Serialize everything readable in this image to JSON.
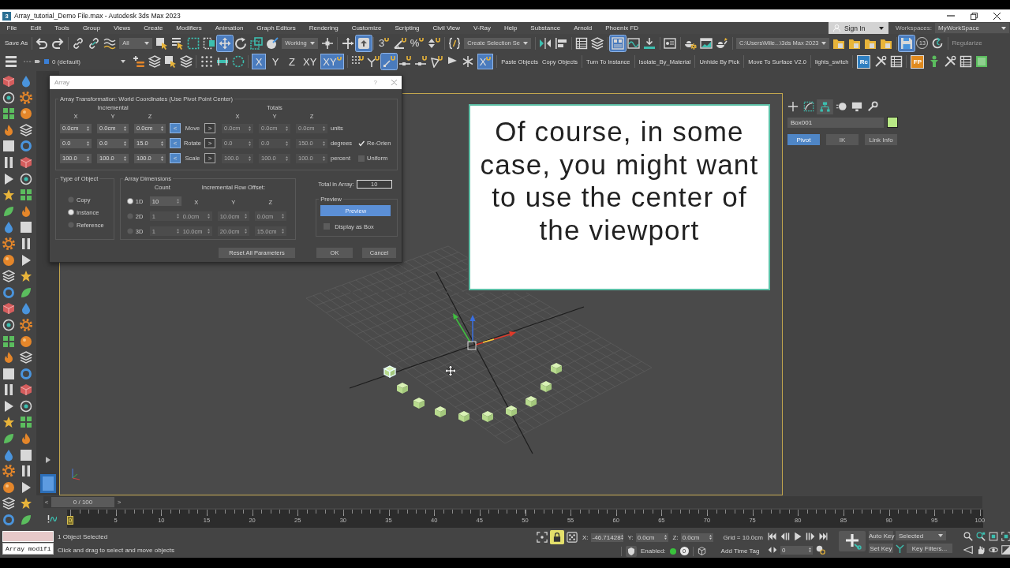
{
  "window": {
    "logo": "3",
    "title": "Array_tutorial_Demo File.max - Autodesk 3ds Max 2023"
  },
  "menu_bar": {
    "items": [
      "File",
      "Edit",
      "Tools",
      "Group",
      "Views",
      "Create",
      "Modifiers",
      "Animation",
      "Graph Editors",
      "Rendering",
      "Customize",
      "Scripting",
      "Civil View",
      "V-Ray",
      "Help",
      "Substance",
      "Arnold",
      "Phoenix FD"
    ],
    "sign_in": "Sign In",
    "workspaces_label": "Workspaces:",
    "workspace": "MyWorkSpace"
  },
  "main_toolbar": [
    [
      {
        "kind": "text",
        "label": "Save As",
        "disabled": false
      }
    ],
    [
      {
        "kind": "undo",
        "active": false
      },
      {
        "kind": "redo",
        "active": false
      }
    ],
    [
      {
        "kind": "link",
        "active": false
      },
      {
        "kind": "unlink",
        "active": false
      },
      {
        "kind": "bind",
        "active": false
      },
      {
        "kind": "dropdown",
        "value": "All"
      },
      {
        "kind": "select",
        "active": false
      },
      {
        "kind": "select-list",
        "active": false
      },
      {
        "kind": "region",
        "active": false
      },
      {
        "kind": "window",
        "active": false
      },
      {
        "kind": "move",
        "active": true
      },
      {
        "kind": "rotate",
        "active": false
      },
      {
        "kind": "scale",
        "active": false
      },
      {
        "kind": "place",
        "active": false
      },
      {
        "kind": "dropdown",
        "value": "Working"
      },
      {
        "kind": "pivot",
        "active": false
      }
    ],
    [
      {
        "kind": "manipulate",
        "active": false
      },
      {
        "kind": "override",
        "active": true
      }
    ],
    [
      {
        "kind": "snap",
        "label": "3",
        "active": false
      },
      {
        "kind": "angle",
        "active": false
      },
      {
        "kind": "snap",
        "label": "%",
        "active": false
      },
      {
        "kind": "spinner",
        "active": false
      }
    ],
    [
      {
        "kind": "braces",
        "active": false
      },
      {
        "kind": "dropdown",
        "value": "Create Selection Se"
      }
    ],
    [
      {
        "kind": "mirror",
        "active": false
      },
      {
        "kind": "align",
        "active": false
      }
    ],
    [
      {
        "kind": "table",
        "active": false
      },
      {
        "kind": "stack",
        "active": false
      }
    ],
    [
      {
        "kind": "ribbon",
        "active": true
      },
      {
        "kind": "curve",
        "active": false
      },
      {
        "kind": "tray",
        "active": false
      }
    ],
    [
      {
        "kind": "material",
        "active": false
      }
    ],
    [
      {
        "kind": "teapot-gear",
        "active": false
      },
      {
        "kind": "frame",
        "active": false
      },
      {
        "kind": "teapot",
        "active": false
      }
    ],
    [
      {
        "kind": "dropdown",
        "value": "C:\\Users\\Mile...\\3ds Max 2023"
      },
      {
        "kind": "folder",
        "active": false
      },
      {
        "kind": "folder",
        "active": false
      },
      {
        "kind": "folder",
        "active": false
      },
      {
        "kind": "folder",
        "active": false
      }
    ],
    [
      {
        "kind": "floppy",
        "active": true
      },
      {
        "kind": "counter",
        "label": "13"
      },
      {
        "kind": "refresh",
        "active": false
      }
    ],
    [
      {
        "kind": "text",
        "label": "Regularize",
        "disabled": true
      }
    ]
  ],
  "secondary_toolbar": [
    [
      {
        "kind": "stack-lines",
        "active": false
      },
      {
        "kind": "layer-dropdown",
        "value": "0 (default)"
      },
      {
        "kind": "add-layer",
        "active": false
      },
      {
        "kind": "stack",
        "active": false
      },
      {
        "kind": "select",
        "active": false
      },
      {
        "kind": "stack",
        "active": false
      }
    ],
    [
      {
        "kind": "dot-grid",
        "active": false
      },
      {
        "kind": "track",
        "active": false
      },
      {
        "kind": "dashed-circle",
        "active": false
      }
    ],
    [
      {
        "kind": "axis",
        "label": "X",
        "active": true
      },
      {
        "kind": "axis",
        "label": "Y",
        "active": false
      },
      {
        "kind": "axis",
        "label": "Z",
        "active": false
      },
      {
        "kind": "axis",
        "label": "XY",
        "active": false
      },
      {
        "kind": "snap",
        "label": "XY",
        "active": true
      }
    ],
    [
      {
        "kind": "dot-snap",
        "active": false
      },
      {
        "kind": "fork",
        "active": false
      },
      {
        "kind": "hook",
        "active": true
      },
      {
        "kind": "dash-snap",
        "active": false
      },
      {
        "kind": "dash-snap",
        "active": false
      },
      {
        "kind": "triangle",
        "active": false
      },
      {
        "kind": "flag",
        "active": false
      },
      {
        "kind": "snowflake",
        "active": false
      },
      {
        "kind": "snap",
        "label": "X",
        "active": true
      }
    ],
    [
      {
        "kind": "text",
        "label": "Paste Objects",
        "disabled": false
      },
      {
        "kind": "text",
        "label": "Copy Objects",
        "disabled": false
      }
    ],
    [
      {
        "kind": "text",
        "label": "Turn To Instance",
        "disabled": false
      }
    ],
    [
      {
        "kind": "text",
        "label": "Isolate_By_Material",
        "disabled": false
      }
    ],
    [
      {
        "kind": "text",
        "label": "Unhide By Pick",
        "disabled": false
      }
    ],
    [
      {
        "kind": "text",
        "label": "Move To Surface V2.0",
        "disabled": false
      }
    ],
    [
      {
        "kind": "text",
        "label": "lights_switch",
        "disabled": false
      }
    ],
    [
      {
        "kind": "tile",
        "label": "Rc",
        "color": "#2f7fc1"
      },
      {
        "kind": "tools",
        "active": false
      },
      {
        "kind": "table",
        "active": false
      }
    ],
    [
      {
        "kind": "tile",
        "label": "FP",
        "color": "#e08a1e"
      },
      {
        "kind": "figure",
        "active": false
      },
      {
        "kind": "tools",
        "active": false
      },
      {
        "kind": "table",
        "active": false
      },
      {
        "kind": "green-box",
        "active": false
      }
    ]
  ],
  "array_dialog": {
    "title": "Array",
    "help": "?",
    "group_title": "Array Transformation: World Coordinates (Use Pivot Point Center)",
    "incremental_label": "Incremental",
    "totals_label": "Totals",
    "incremental_axes": [
      "X",
      "Y",
      "Z"
    ],
    "totals_axes": [
      "X",
      "Y",
      "Z"
    ],
    "rows": [
      {
        "label": "Move",
        "incremental": [
          "0.0cm",
          "0.0cm",
          "0.0cm"
        ],
        "left_button": {
          "label": "<",
          "selected": true
        },
        "right_button": {
          "label": ">",
          "selected": false
        },
        "totals": [
          "0.0cm",
          "0.0cm",
          "0.0cm"
        ],
        "unit": "units"
      },
      {
        "label": "Rotate",
        "incremental": [
          "0.0",
          "0.0",
          "15.0"
        ],
        "left_button": {
          "label": "<",
          "selected": true
        },
        "right_button": {
          "label": ">",
          "selected": false
        },
        "totals": [
          "0.0",
          "0.0",
          "150.0"
        ],
        "unit": "degrees",
        "option": {
          "label": "Re-Orien",
          "checked": true
        }
      },
      {
        "label": "Scale",
        "incremental": [
          "100.0",
          "100.0",
          "100.0"
        ],
        "left_button": {
          "label": "<",
          "selected": true
        },
        "right_button": {
          "label": ">",
          "selected": false
        },
        "totals": [
          "100.0",
          "100.0",
          "100.0"
        ],
        "unit": "percent",
        "option": {
          "label": "Uniform",
          "checked": false
        }
      }
    ],
    "type_of_object": {
      "title": "Type of Object",
      "options": [
        {
          "label": "Copy",
          "selected": false
        },
        {
          "label": "Instance",
          "selected": true
        },
        {
          "label": "Reference",
          "selected": false
        }
      ]
    },
    "array_dimensions": {
      "title": "Array Dimensions",
      "count_label": "Count",
      "offset_label": "Incremental Row Offset:",
      "axes": [
        "X",
        "Y",
        "Z"
      ],
      "rows": [
        {
          "label": "1D",
          "selected": true,
          "count": "10"
        },
        {
          "label": "2D",
          "selected": false,
          "count": "1",
          "offsets": [
            "0.0cm",
            "10.0cm",
            "0.0cm"
          ]
        },
        {
          "label": "3D",
          "selected": false,
          "count": "1",
          "offsets": [
            "10.0cm",
            "20.0cm",
            "15.0cm"
          ]
        }
      ]
    },
    "total_label": "Total in Array:",
    "total": "10",
    "preview": {
      "title": "Preview",
      "button": {
        "label": "Preview",
        "on": true
      },
      "display_as_box": {
        "label": "Display as Box",
        "checked": false
      }
    },
    "buttons": [
      "Reset All Parameters",
      "OK",
      "Cancel"
    ]
  },
  "viewport": {
    "objects": [
      {
        "selected": true
      },
      {
        "selected": false
      },
      {
        "selected": false
      },
      {
        "selected": false
      },
      {
        "selected": false
      },
      {
        "selected": false
      },
      {
        "selected": false
      },
      {
        "selected": false
      },
      {
        "selected": false
      },
      {
        "selected": false
      }
    ]
  },
  "caption": "Of course, in some case, you might want to use the center of the viewport",
  "command_panel": {
    "tabs": [
      {
        "kind": "create",
        "selected": false
      },
      {
        "kind": "modify",
        "selected": false
      },
      {
        "kind": "hierarchy",
        "selected": true
      },
      {
        "kind": "motion",
        "selected": false
      },
      {
        "kind": "display",
        "selected": false
      },
      {
        "kind": "utilities",
        "selected": false
      }
    ],
    "object_name": "Box001",
    "buttons": [
      {
        "label": "Pivot",
        "selected": true
      },
      {
        "label": "IK",
        "selected": false
      },
      {
        "label": "Link Info",
        "selected": false
      }
    ]
  },
  "time_slider": {
    "prev": "<",
    "label": "0 / 100",
    "next": ">",
    "level": 0
  },
  "track_bar": {
    "labels": [
      {
        "text": "0",
        "current": true
      },
      {
        "text": "5",
        "current": false
      },
      {
        "text": "10",
        "current": false
      },
      {
        "text": "15",
        "current": false
      },
      {
        "text": "20",
        "current": false
      },
      {
        "text": "25",
        "current": false
      },
      {
        "text": "30",
        "current": false
      },
      {
        "text": "35",
        "current": false
      },
      {
        "text": "40",
        "current": false
      },
      {
        "text": "45",
        "current": false
      },
      {
        "text": "50",
        "current": false
      },
      {
        "text": "55",
        "current": false
      },
      {
        "text": "60",
        "current": false
      },
      {
        "text": "65",
        "current": false
      },
      {
        "text": "70",
        "current": false
      },
      {
        "text": "75",
        "current": false
      },
      {
        "text": "80",
        "current": false
      },
      {
        "text": "85",
        "current": false
      },
      {
        "text": "90",
        "current": false
      },
      {
        "text": "95",
        "current": false
      },
      {
        "text": "100",
        "current": false
      }
    ]
  },
  "status_bar": {
    "script_output": "Array modifi",
    "selection_info": "1 Object Selected",
    "prompt": "Click and drag to select and move objects",
    "selection_lock": true,
    "coordinates": [
      {
        "axis": "X:",
        "value": "-46.71428"
      },
      {
        "axis": "Y:",
        "value": "0.0cm"
      },
      {
        "axis": "Z:",
        "value": "0.0cm"
      }
    ],
    "grid": "Grid = 10.0cm",
    "adaptive_label": "Enabled:",
    "adaptive_enabled": true,
    "adaptive_count": "0",
    "time_tag": "Add Time Tag",
    "frame": "0",
    "auto_key": {
      "label": "Auto Key",
      "on": false
    },
    "set_key": "Set Key",
    "key_mode": "Selected",
    "key_filters": "Key Filters..."
  }
}
